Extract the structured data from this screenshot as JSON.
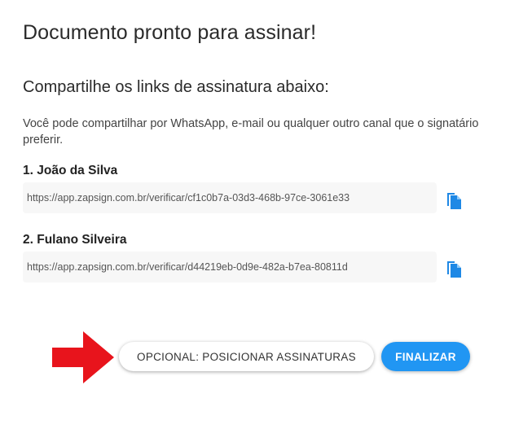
{
  "header": {
    "title": "Documento pronto para assinar!"
  },
  "share": {
    "heading": "Compartilhe os links de assinatura abaixo:",
    "description": "Você pode compartilhar por WhatsApp, e-mail ou qualquer outro canal que o signatário preferir."
  },
  "signers": [
    {
      "name": "1. João da Silva",
      "link": "https://app.zapsign.com.br/verificar/cf1c0b7a-03d3-468b-97ce-3061e33",
      "copy_icon": "copy-icon"
    },
    {
      "name": "2. Fulano Silveira",
      "link": "https://app.zapsign.com.br/verificar/d44219eb-0d9e-482a-b7ea-80811d",
      "copy_icon": "copy-icon"
    }
  ],
  "actions": {
    "optional_label": "OPCIONAL: POSICIONAR ASSINATURAS",
    "finalize_label": "FINALIZAR"
  },
  "colors": {
    "accent": "#2196f3",
    "arrow": "#e8141c",
    "link_bg": "#f7f7f7"
  }
}
